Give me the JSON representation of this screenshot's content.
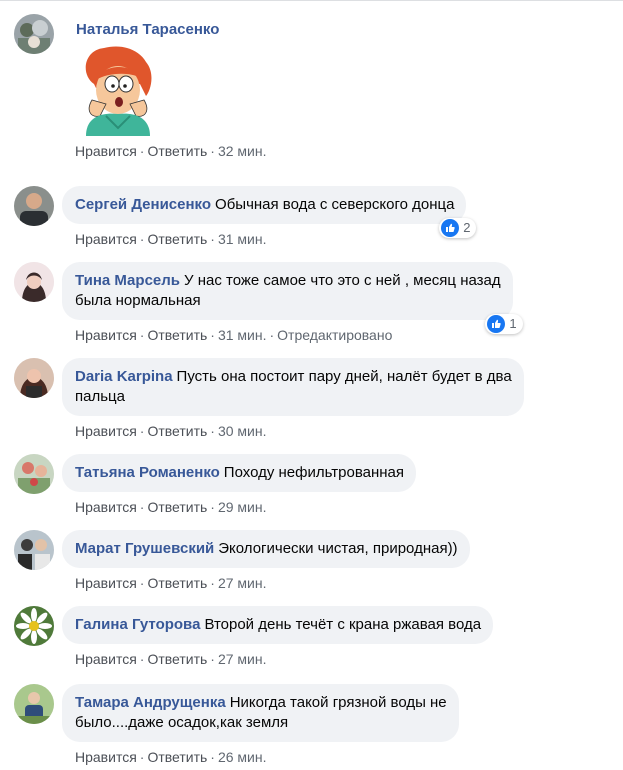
{
  "actions": {
    "like": "Нравится",
    "reply": "Ответить",
    "separator": "·"
  },
  "comments": [
    {
      "author": "Наталья Тарасенко",
      "text": "",
      "time": "32 мин.",
      "edited": "",
      "likes": "",
      "sticker": "cartoon-woman-sticker"
    },
    {
      "author": "Сергей Денисенко",
      "text": "Обычная вода с северского донца",
      "time": "31 мин.",
      "edited": "",
      "likes": "2"
    },
    {
      "author": "Тина Марсель",
      "text": "У нас тоже самое что это с ней , месяц назад\nбыла нормальная",
      "time": "31 мин.",
      "edited": "Отредактировано",
      "likes": "1"
    },
    {
      "author": "Daria Karpina",
      "text": "Пусть она постоит пару дней, налёт будет в два\nпальца",
      "time": "30 мин.",
      "edited": "",
      "likes": ""
    },
    {
      "author": "Татьяна Романенко",
      "text": "Походу нефильтрованная",
      "time": "29 мин.",
      "edited": "",
      "likes": ""
    },
    {
      "author": "Марат Грушевский",
      "text": "Экологически чистая, природная))",
      "time": "27 мин.",
      "edited": "",
      "likes": ""
    },
    {
      "author": "Галина Гуторова",
      "text": "Второй день течёт с крана ржавая вода",
      "time": "27 мин.",
      "edited": "",
      "likes": ""
    },
    {
      "author": "Тамара Андрущенка",
      "text": "Никогда такой грязной воды не\nбыло....даже осадок,как земля",
      "time": "26 мин.",
      "edited": "",
      "likes": ""
    }
  ],
  "colors": {
    "author": "#385898",
    "bubble": "#f0f2f5",
    "like_badge": "#1877f2",
    "meta": "#606770"
  }
}
